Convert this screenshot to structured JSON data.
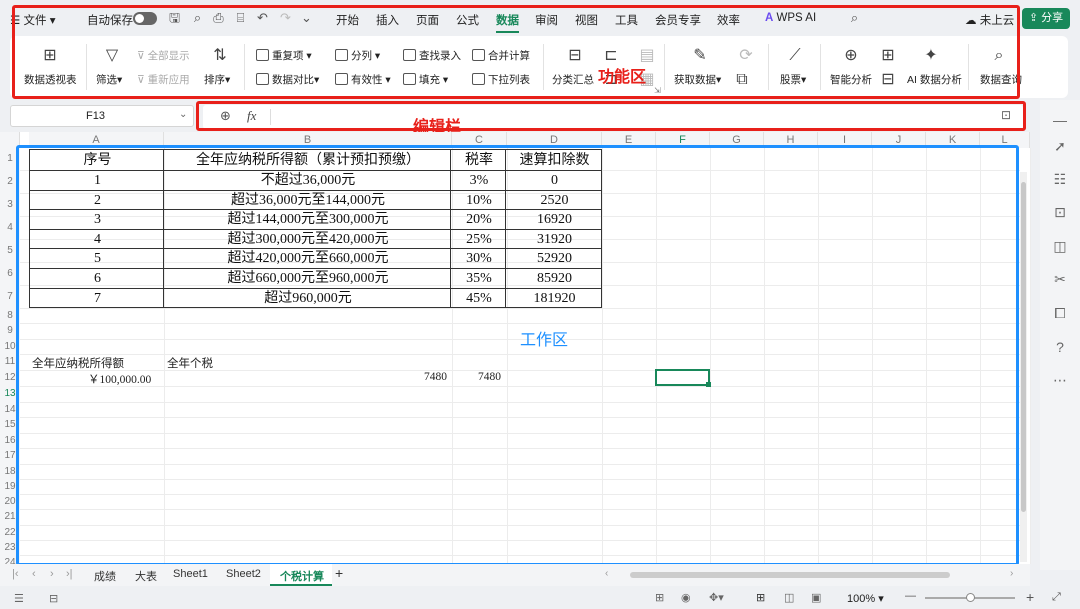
{
  "topbar": {
    "file": "文件",
    "autosave": "自动保存",
    "menus": [
      "开始",
      "插入",
      "页面",
      "公式",
      "数据",
      "审阅",
      "视图",
      "工具",
      "会员专享",
      "效率"
    ],
    "wps_ai": "WPS AI",
    "cloud": "未上云",
    "share": "分享"
  },
  "ribbon": {
    "pivot": "数据透视表",
    "filter": "筛选",
    "show_all": "全部显示",
    "reapply": "重新应用",
    "sort": "排序",
    "dup": "重复项",
    "compare": "数据对比",
    "split": "分列",
    "validity": "有效性",
    "lookup": "查找录入",
    "fill": "填充",
    "merge_calc": "合并计算",
    "dropdown": "下拉列表",
    "subtotal": "分类汇总",
    "get_data": "获取数据",
    "stocks": "股票",
    "smart_analysis": "智能分析",
    "ai_analysis": "AI 数据分析",
    "data_query": "数据查询"
  },
  "annotations": {
    "ribbon": "功能区",
    "formula": "编辑栏",
    "work": "工作区"
  },
  "formula": {
    "cell_ref": "F13",
    "fx": "fx"
  },
  "columns": [
    "A",
    "B",
    "C",
    "D",
    "E",
    "F",
    "G",
    "H",
    "I",
    "J",
    "K",
    "L"
  ],
  "rows": [
    "1",
    "2",
    "3",
    "4",
    "5",
    "6",
    "7",
    "8",
    "9",
    "10",
    "11",
    "12",
    "13",
    "14",
    "15",
    "16",
    "17",
    "18",
    "19",
    "20",
    "21",
    "22",
    "23",
    "24"
  ],
  "table": {
    "headers": [
      "序号",
      "全年应纳税所得额（累计预扣预缴）",
      "税率",
      "速算扣除数"
    ],
    "rows": [
      [
        "1",
        "不超过36,000元",
        "3%",
        "0"
      ],
      [
        "2",
        "超过36,000元至144,000元",
        "10%",
        "2520"
      ],
      [
        "3",
        "超过144,000元至300,000元",
        "20%",
        "16920"
      ],
      [
        "4",
        "超过300,000元至420,000元",
        "25%",
        "31920"
      ],
      [
        "5",
        "超过420,000元至660,000元",
        "30%",
        "52920"
      ],
      [
        "6",
        "超过660,000元至960,000元",
        "35%",
        "85920"
      ],
      [
        "7",
        "超过960,000元",
        "45%",
        "181920"
      ]
    ]
  },
  "calc": {
    "label_income": "全年应纳税所得额",
    "label_tax": "全年个税",
    "income": "￥100,000.00",
    "b13": "7480",
    "c13": "7480"
  },
  "sheets": [
    "成绩",
    "大表",
    "Sheet1",
    "Sheet2",
    "个税计算"
  ],
  "active_sheet": "个税计算",
  "status": {
    "zoom": "100%"
  },
  "colors": {
    "accent": "#18885a",
    "annotation_red": "#e8201a",
    "annotation_blue": "#1e90ff"
  }
}
